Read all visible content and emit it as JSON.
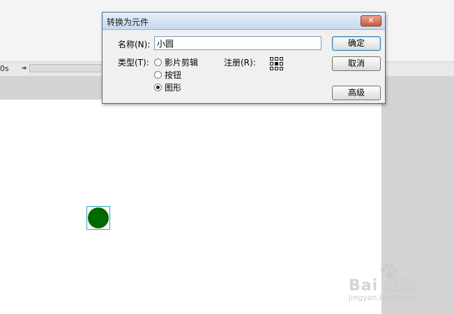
{
  "background": {
    "time_label": "0s",
    "scroll_left_arrow": "◄"
  },
  "dialog": {
    "title": "转换为元件",
    "close_glyph": "✕",
    "name_label": "名称(N):",
    "name_value": "小圆",
    "type_label": "类型(T):",
    "types": [
      {
        "label": "影片剪辑",
        "selected": false
      },
      {
        "label": "按钮",
        "selected": false
      },
      {
        "label": "图形",
        "selected": true
      }
    ],
    "registration_label": "注册(R):",
    "ok_label": "确定",
    "cancel_label": "取消",
    "advanced_label": "高级"
  },
  "stage": {
    "shape_color": "#006a00",
    "selection_color": "#29a6b7"
  },
  "watermark": {
    "main": "Bai 经验",
    "sub": "jingyan.baidu.com"
  }
}
